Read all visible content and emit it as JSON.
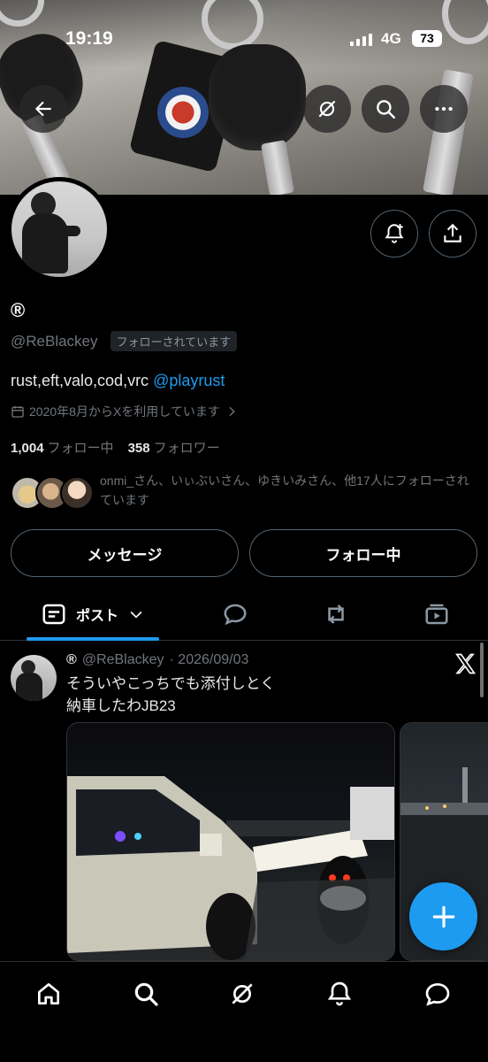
{
  "status_bar": {
    "time": "19:19",
    "network": "4G",
    "battery": "73"
  },
  "profile": {
    "display_name": "®",
    "handle": "@ReBlackey",
    "follows_you_badge": "フォローされています",
    "bio_text": "rust,eft,valo,cod,vrc",
    "bio_mention": "@playrust",
    "joined": "2020年8月からXを利用しています",
    "following_count": "1,004",
    "following_label": "フォロー中",
    "followers_count": "358",
    "followers_label": "フォロワー",
    "followed_by_text": "onmi_さん、いぃぶいさん、ゆきいみさん、他17人にフォローされています"
  },
  "actions": {
    "message_label": "メッセージ",
    "following_label": "フォロー中"
  },
  "tabs": [
    {
      "label": "ポスト",
      "icon": "posts-icon",
      "selected": true
    },
    {
      "label": "",
      "icon": "replies-icon"
    },
    {
      "label": "",
      "icon": "reposts-icon"
    },
    {
      "label": "",
      "icon": "media-icon"
    }
  ],
  "post": {
    "author_name": "®",
    "author_handle": "@ReBlackey",
    "date": "· 2026/09/03",
    "text_line1": "そういやこっちでも添付しとく",
    "text_line2": "納車したわJB23"
  },
  "bottom_nav": [
    "home-icon",
    "search-icon",
    "grok-icon",
    "notifications-icon",
    "messages-icon"
  ],
  "colors": {
    "accent": "#1d9bf0",
    "background": "#000000",
    "muted": "#71767b",
    "border": "#536471"
  }
}
